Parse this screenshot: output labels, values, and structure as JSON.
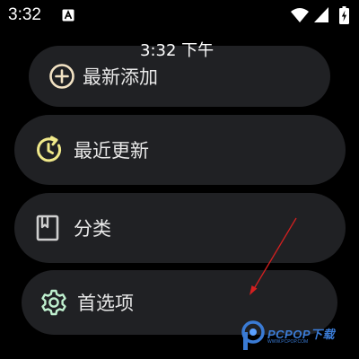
{
  "status_bar": {
    "time": "3:32",
    "icons": [
      "notification-a-icon",
      "wifi-icon",
      "signal-icon",
      "battery-charging-icon"
    ]
  },
  "clock_overlay": "3:32 下午",
  "menu": {
    "items": [
      {
        "label": "最新添加",
        "icon": "add-circle-icon",
        "icon_color": "#f3e3c4"
      },
      {
        "label": "最近更新",
        "icon": "update-clock-icon",
        "icon_color": "#f0e98a"
      },
      {
        "label": "分类",
        "icon": "bookmark-book-icon",
        "icon_color": "#cfcfcf"
      },
      {
        "label": "首选项",
        "icon": "settings-gear-icon",
        "icon_color": "#bff0cf"
      }
    ]
  },
  "watermark": {
    "text": "PCPOP下载",
    "subtext": "WWW.PCPOP.COM"
  },
  "colors": {
    "background": "#000000",
    "item_background": "#202124",
    "text": "#e8e8e8",
    "annotation_arrow": "#d42020",
    "watermark": "#3a7bd5"
  }
}
